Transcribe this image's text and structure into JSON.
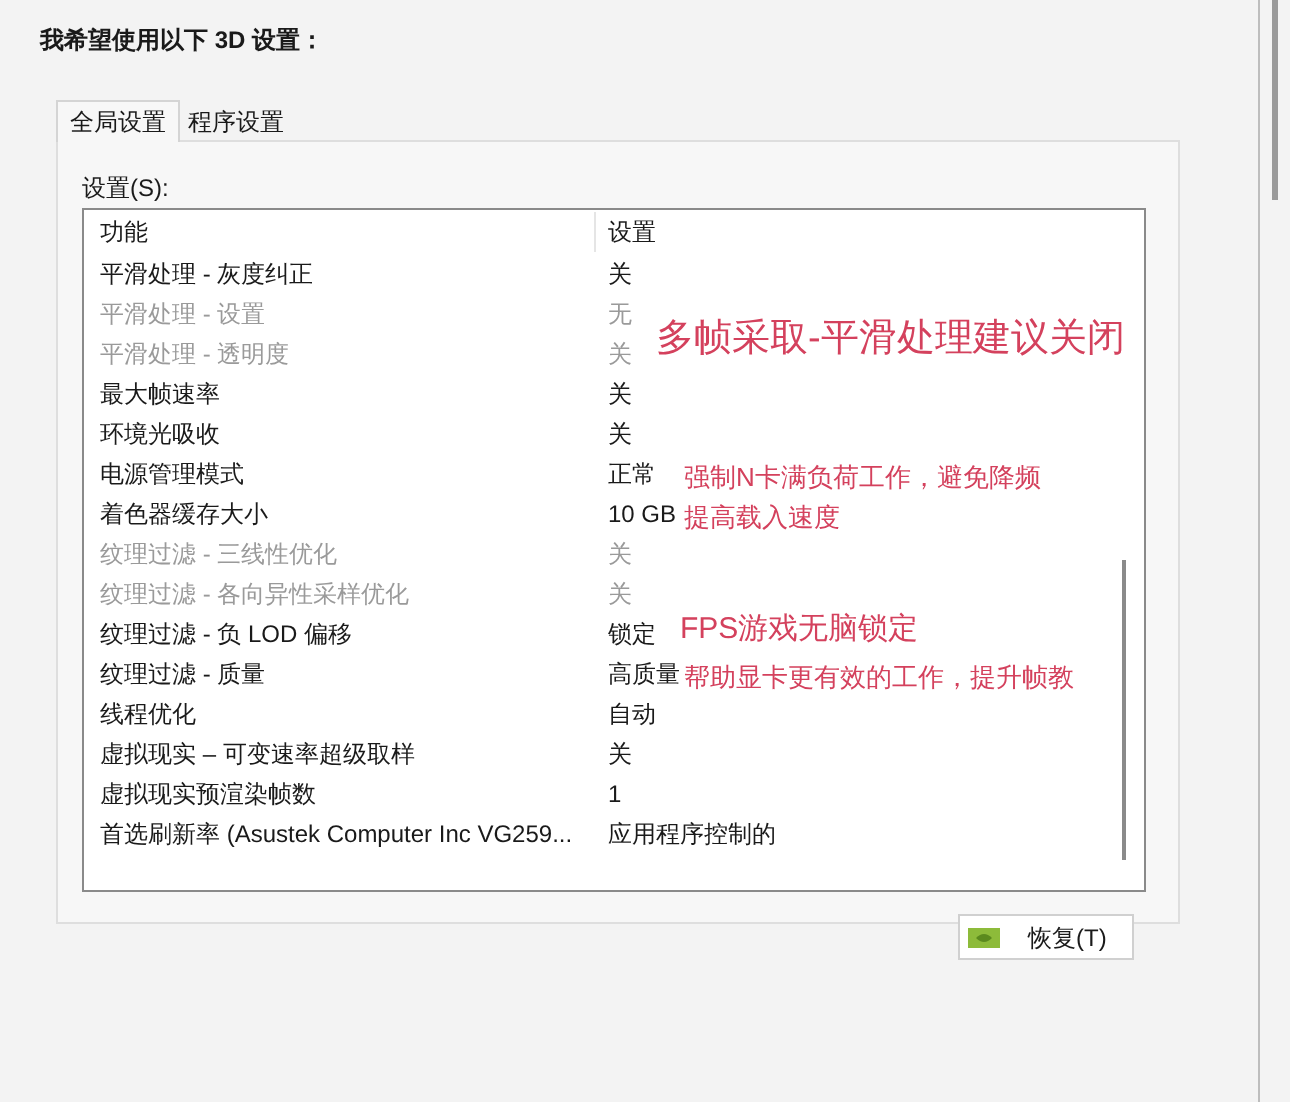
{
  "heading": "我希望使用以下 3D 设置：",
  "tabs": [
    {
      "label": "全局设置",
      "selected": true
    },
    {
      "label": "程序设置",
      "selected": false
    }
  ],
  "settings_label": "设置(S):",
  "table": {
    "columns": [
      "功能",
      "设置"
    ],
    "rows": [
      {
        "feature": "平滑处理 - 灰度纠正",
        "value": "关",
        "disabled": false
      },
      {
        "feature": "平滑处理 - 设置",
        "value": "无",
        "disabled": true,
        "note": {
          "kind": "large",
          "text": "多帧采取-平滑处理建议关闭"
        }
      },
      {
        "feature": "平滑处理 - 透明度",
        "value": "关",
        "disabled": true
      },
      {
        "feature": "最大帧速率",
        "value": "关",
        "disabled": false
      },
      {
        "feature": "环境光吸收",
        "value": "关",
        "disabled": false
      },
      {
        "feature": "电源管理模式",
        "value": "正常",
        "disabled": false,
        "note": {
          "kind": "small",
          "text": "强制N卡满负荷工作，避免降频"
        }
      },
      {
        "feature": "着色器缓存大小",
        "value": "10 GB",
        "disabled": false,
        "note": {
          "kind": "small",
          "text": "提高载入速度"
        }
      },
      {
        "feature": "纹理过滤 - 三线性优化",
        "value": "关",
        "disabled": true
      },
      {
        "feature": "纹理过滤 - 各向异性采样优化",
        "value": "关",
        "disabled": true
      },
      {
        "feature": "纹理过滤 - 负 LOD 偏移",
        "value": "锁定",
        "disabled": false,
        "note": {
          "kind": "medium",
          "text": "FPS游戏无脑锁定"
        }
      },
      {
        "feature": "纹理过滤 - 质量",
        "value": "高质量",
        "disabled": false,
        "note": {
          "kind": "small",
          "text": "帮助显卡更有效的工作，提升帧教"
        }
      },
      {
        "feature": "线程优化",
        "value": "自动",
        "disabled": false
      },
      {
        "feature": "虚拟现实 – 可变速率超级取样",
        "value": "关",
        "disabled": false
      },
      {
        "feature": "虚拟现实预渲染帧数",
        "value": "1",
        "disabled": false
      },
      {
        "feature": "首选刷新率 (Asustek Computer Inc VG259...",
        "value": "应用程序控制的",
        "disabled": false
      }
    ]
  },
  "restore_button": "恢复(T)"
}
